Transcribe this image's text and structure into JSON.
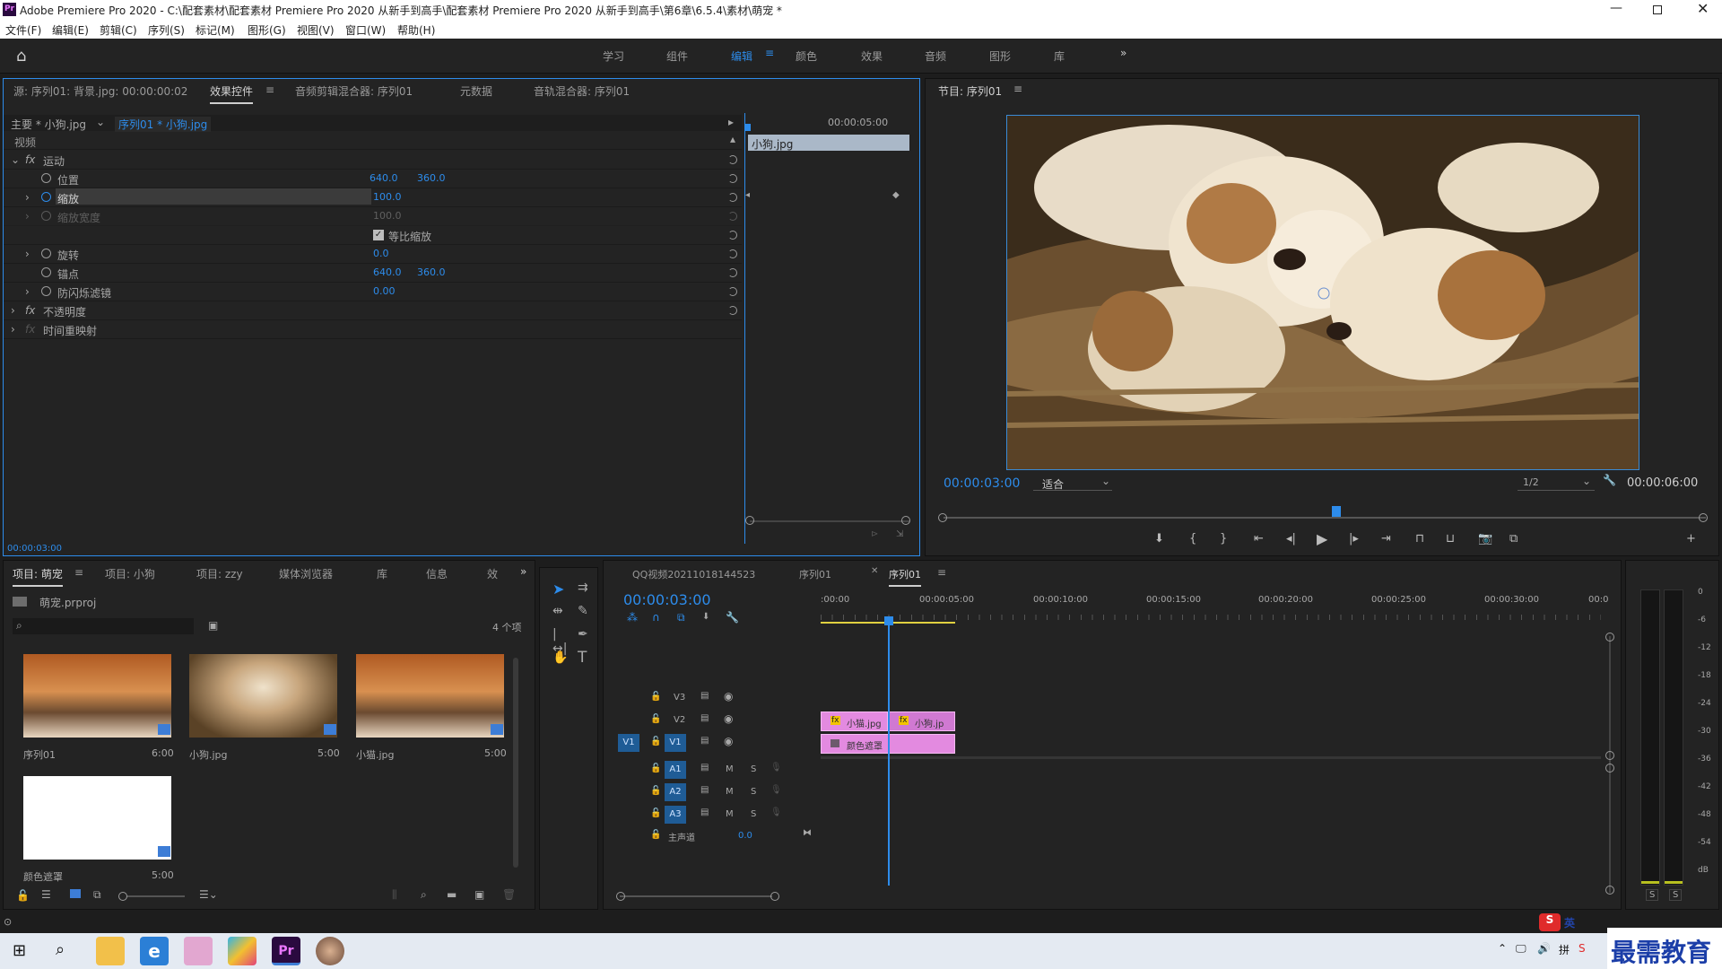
{
  "window": {
    "title": "Adobe Premiere Pro 2020 - C:\\配套素材\\配套素材 Premiere Pro 2020 从新手到高手\\配套素材 Premiere Pro 2020 从新手到高手\\第6章\\6.5.4\\素材\\萌宠 *",
    "app_icon": "Pr"
  },
  "menu": [
    "文件(F)",
    "编辑(E)",
    "剪辑(C)",
    "序列(S)",
    "标记(M)",
    "图形(G)",
    "视图(V)",
    "窗口(W)",
    "帮助(H)"
  ],
  "workspaces": [
    "学习",
    "组件",
    "编辑",
    "颜色",
    "效果",
    "音频",
    "图形",
    "库"
  ],
  "workspace_active": "编辑",
  "effect_panel": {
    "tabs": [
      "源: 序列01: 背景.jpg: 00:00:00:02",
      "效果控件",
      "音频剪辑混合器: 序列01",
      "元数据",
      "音轨混合器: 序列01"
    ],
    "master_label": "主要 * 小狗.jpg",
    "sequence_label": "序列01 * 小狗.jpg",
    "mini_timecode": "00:00:05:00",
    "clip_bar_label": "小狗.jpg",
    "section_video": "视频",
    "motion": "运动",
    "params": [
      {
        "name": "位置",
        "v1": "640.0",
        "v2": "360.0"
      },
      {
        "name": "缩放",
        "v1": "100.0",
        "v2": ""
      },
      {
        "name": "缩放宽度",
        "v1": "100.0",
        "v2": ""
      },
      {
        "name": "旋转",
        "v1": "0.0",
        "v2": ""
      },
      {
        "name": "锚点",
        "v1": "640.0",
        "v2": "360.0"
      },
      {
        "name": "防闪烁滤镜",
        "v1": "0.00",
        "v2": ""
      }
    ],
    "uniform_scale": "等比缩放",
    "opacity": "不透明度",
    "time_remap": "时间重映射",
    "timecode": "00:00:03:00"
  },
  "program": {
    "title": "节目: 序列01",
    "timecode": "00:00:03:00",
    "fit": "适合",
    "quality": "1/2",
    "duration": "00:00:06:00"
  },
  "project": {
    "tabs": [
      "项目: 萌宠",
      "项目: 小狗",
      "项目: zzy",
      "媒体浏览器",
      "库",
      "信息",
      "效"
    ],
    "file": "萌宠.prproj",
    "count": "4 个项",
    "items": [
      {
        "name": "序列01",
        "dur": "6:00"
      },
      {
        "name": "小狗.jpg",
        "dur": "5:00"
      },
      {
        "name": "小猫.jpg",
        "dur": "5:00"
      },
      {
        "name": "颜色遮罩",
        "dur": "5:00"
      }
    ]
  },
  "timeline": {
    "tabs": [
      "QQ视频20211018144523",
      "序列01",
      "序列01"
    ],
    "timecode": "00:00:03:00",
    "ruler": [
      ":00:00",
      "00:00:05:00",
      "00:00:10:00",
      "00:00:15:00",
      "00:00:20:00",
      "00:00:25:00",
      "00:00:30:00",
      "00:0"
    ],
    "video_tracks": [
      "V3",
      "V2",
      "V1"
    ],
    "audio_tracks": [
      "A1",
      "A2",
      "A3"
    ],
    "src_v1": "V1",
    "m": "M",
    "s": "S",
    "master": "主声道",
    "master_val": "0.0",
    "clips": {
      "v2a": "小猫.jpg",
      "v2b": "小狗.jp",
      "v1": "颜色遮罩"
    }
  },
  "meter": {
    "labels": [
      "0",
      "-6",
      "-12",
      "-18",
      "-24",
      "-30",
      "-36",
      "-42",
      "-48",
      "-54",
      "dB"
    ],
    "solo": [
      "S",
      "S"
    ]
  },
  "taskbar": {
    "ime": "英",
    "watermark": "最需教育"
  }
}
